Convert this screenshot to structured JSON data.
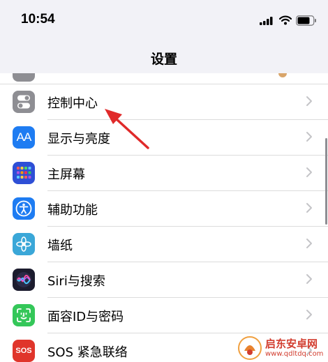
{
  "status_bar": {
    "time": "10:54"
  },
  "nav": {
    "title": "设置"
  },
  "settings": {
    "items": [
      {
        "label": "控制中心",
        "icon": "control-center-icon",
        "color": "#8e8e93"
      },
      {
        "label": "显示与亮度",
        "icon": "display-brightness-icon",
        "color": "#1e7cf2",
        "icon_text": "AA"
      },
      {
        "label": "主屏幕",
        "icon": "home-screen-icon",
        "color": "#2e4fd6"
      },
      {
        "label": "辅助功能",
        "icon": "accessibility-icon",
        "color": "#1e7cf2"
      },
      {
        "label": "墙纸",
        "icon": "wallpaper-icon",
        "color": "#3aa7d8"
      },
      {
        "label": "Siri与搜索",
        "icon": "siri-icon",
        "color": "#1c1c2e"
      },
      {
        "label": "面容ID与密码",
        "icon": "face-id-icon",
        "color": "#34c759"
      },
      {
        "label": "SOS 紧急联络",
        "icon": "sos-icon",
        "color": "#e0352b",
        "icon_text": "SOS"
      }
    ]
  },
  "watermark": {
    "name": "启东安卓网",
    "url": "www.qdltdq.com"
  }
}
